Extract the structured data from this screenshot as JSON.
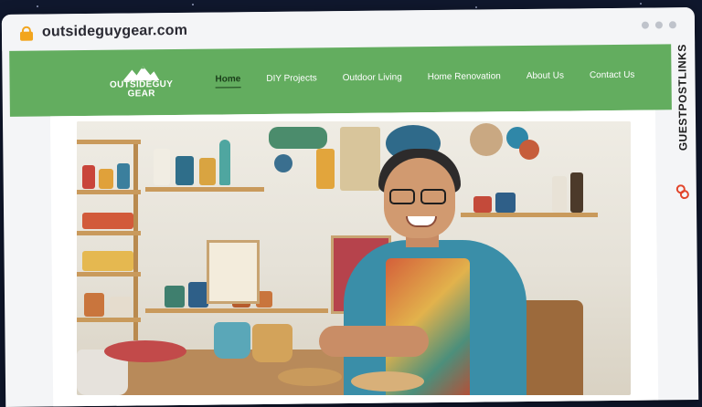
{
  "browser": {
    "url": "outsideguygear.com",
    "lock_icon": "lock-icon",
    "window_dots": 3
  },
  "site": {
    "logo_text_line1": "OUTSIDEGUY",
    "logo_text_line2": "GEAR",
    "logo_icon": "mountain-icon",
    "brand_color": "#63ad5f",
    "nav": [
      {
        "label": "Home",
        "active": true
      },
      {
        "label": "DIY Projects",
        "active": false
      },
      {
        "label": "Outdoor Living",
        "active": false
      },
      {
        "label": "Home Renovation",
        "active": false
      },
      {
        "label": "About Us",
        "active": false
      },
      {
        "label": "Contact Us",
        "active": false
      }
    ]
  },
  "watermark": {
    "text": "GUESTPOSTLINKS",
    "icon": "guestpostlinks-logo-icon",
    "accent_color": "#e2452b"
  },
  "hero": {
    "subject": "hero-photo"
  }
}
